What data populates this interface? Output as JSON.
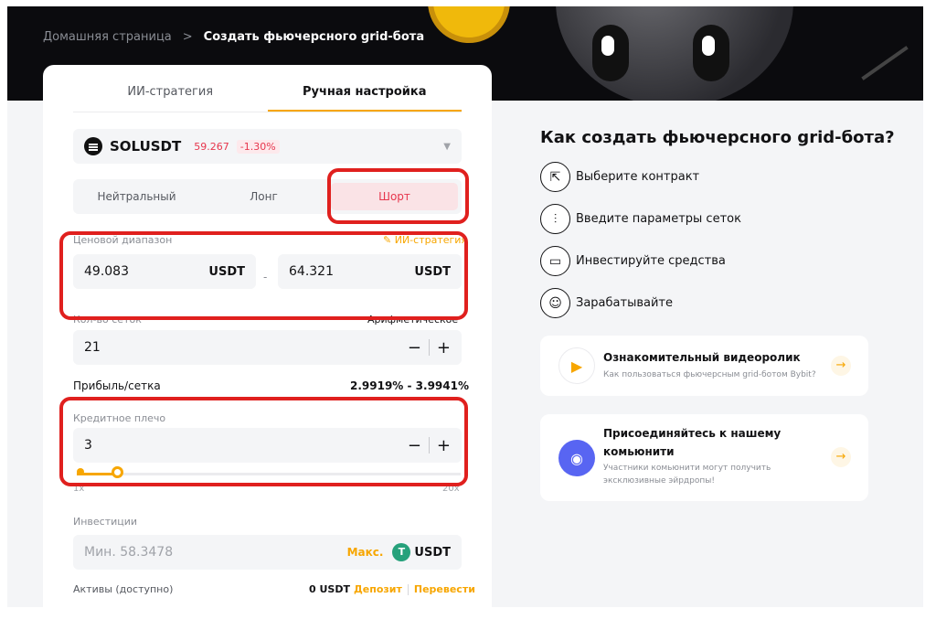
{
  "breadcrumb": {
    "home": "Домашняя страница",
    "separator": ">",
    "current": "Создать фьючерсного grid-бота"
  },
  "tabs": [
    {
      "label": "ИИ-стратегия",
      "active": false
    },
    {
      "label": "Ручная настройка",
      "active": true
    }
  ],
  "pair": {
    "symbol": "SOLUSDT",
    "price": "59.267",
    "change": "-1.30%",
    "icon": "solana-icon",
    "color_down": "#e7364d"
  },
  "modes": [
    {
      "label": "Нейтральный",
      "active": false
    },
    {
      "label": "Лонг",
      "active": false
    },
    {
      "label": "Шорт",
      "active": true
    }
  ],
  "price_range": {
    "label": "Ценовой диапазон",
    "ai_link": "ИИ-стратегия",
    "lower": "49.083",
    "upper": "64.321",
    "unit": "USDT",
    "separator": "-"
  },
  "grids": {
    "label": "Кол-во сеток",
    "mode": "Арифметическое",
    "value": "21",
    "minus": "−",
    "plus": "+"
  },
  "profit": {
    "label": "Прибыль/сетка",
    "value": "2.9919% - 3.9941%"
  },
  "leverage": {
    "label": "Кредитное плечо",
    "value": "3",
    "minus": "−",
    "plus": "+",
    "slider_min": "1x",
    "slider_max": "20x",
    "level": 3,
    "min": 1,
    "max": 20
  },
  "investment": {
    "label": "Инвестиции",
    "placeholder": "Мин. 58.3478",
    "max_label": "Макс.",
    "currency": "USDT",
    "currency_glyph": "T"
  },
  "assets": {
    "label": "Активы (доступно)",
    "balance": "0 USDT",
    "deposit": "Депозит",
    "transfer": "Перевести"
  },
  "how_to": {
    "title": "Как создать фьючерсного grid-бота?",
    "steps": [
      {
        "label": "Выберите контракт",
        "icon": "contract-select-icon",
        "glyph": "⇱"
      },
      {
        "label": "Введите параметры сеток",
        "icon": "sliders-icon",
        "glyph": "⫶"
      },
      {
        "label": "Инвестируйте средства",
        "icon": "wallet-icon",
        "glyph": "▭"
      },
      {
        "label": "Зарабатывайте",
        "icon": "earn-icon",
        "glyph": "☺"
      }
    ]
  },
  "video_promo": {
    "title": "Ознакомительный видеоролик",
    "subtitle": "Как пользоваться фьючерсным grid-ботом Bybit?",
    "icon": "video-icon",
    "glyph": "▶",
    "arrow": "→"
  },
  "community_promo": {
    "title_line1": "Присоединяйтесь к нашему",
    "title_line2": "комьюнити",
    "subtitle_line1": "Участники комьюнити могут получить",
    "subtitle_line2": "эксклюзивные эйрдропы!",
    "icon": "discord-icon",
    "glyph": "◉",
    "arrow": "→"
  },
  "colors": {
    "accent": "#f7a600",
    "highlight": "#e0201e",
    "discord": "#5865f2",
    "usdt": "#26a17b"
  }
}
